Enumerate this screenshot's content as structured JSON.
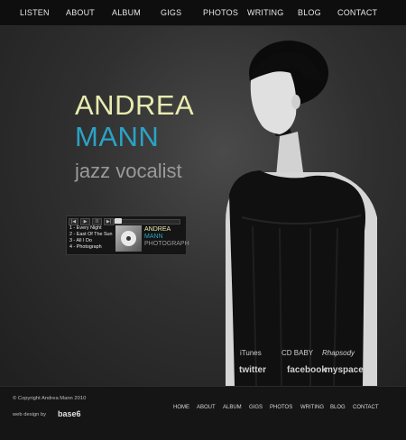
{
  "nav": {
    "items": [
      "LISTEN",
      "ABOUT",
      "ALBUM",
      "GIGS",
      "PHOTOS",
      "WRITING",
      "BLOG",
      "CONTACT"
    ]
  },
  "hero": {
    "name_first": "ANDREA",
    "name_last": "MANN",
    "subtitle": "jazz vocalist"
  },
  "player": {
    "tracks": [
      "1 - Every Night",
      "2 - East Of The Sun",
      "3 - All I Do",
      "4 - Photograph"
    ],
    "album_lines": [
      "ANDREA",
      "MANN",
      "PHOTOGRAPH"
    ],
    "controls": [
      "prev-icon",
      "play-icon",
      "pause-icon",
      "next-icon"
    ]
  },
  "links": {
    "itunes": "iTunes",
    "cdbaby": "CD BABY",
    "rhapsody": "Rhapsody",
    "twitter": "twitter",
    "facebook": "facebook",
    "myspace": "myspace"
  },
  "footer": {
    "copyright": "© Copyright Andrea Mann 2010",
    "design_by": "web design by",
    "design_logo": "base6",
    "nav": [
      "HOME",
      "ABOUT",
      "ALBUM",
      "GIGS",
      "PHOTOS",
      "WRITING",
      "BLOG",
      "CONTACT"
    ]
  },
  "colors": {
    "accent_blue": "#2aa3c6",
    "accent_cream": "#e9ecae"
  }
}
